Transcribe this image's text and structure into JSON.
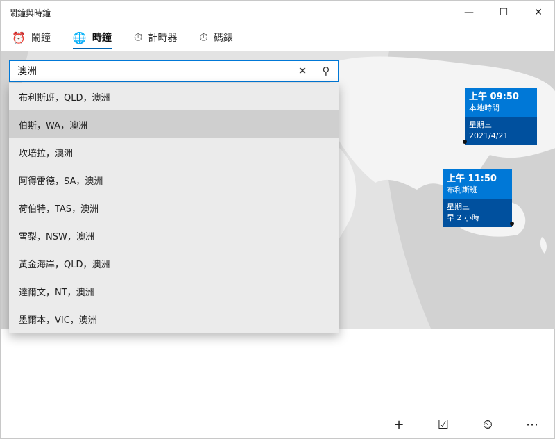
{
  "window": {
    "title": "鬧鐘與時鐘",
    "minimize_glyph": "—",
    "maximize_glyph": "☐",
    "close_glyph": "✕"
  },
  "tabs": [
    {
      "label": "鬧鐘",
      "icon": "alarm-icon",
      "glyph": "⏰",
      "active": false
    },
    {
      "label": "時鐘",
      "icon": "world-clock-icon",
      "glyph": "🌐",
      "active": true
    },
    {
      "label": "計時器",
      "icon": "timer-icon",
      "glyph": "⏱",
      "active": false
    },
    {
      "label": "碼錶",
      "icon": "stopwatch-icon",
      "glyph": "⏱",
      "active": false
    }
  ],
  "search": {
    "value": "澳洲",
    "clear_glyph": "✕",
    "search_glyph": "⚲"
  },
  "suggestions": [
    "布利斯班，QLD，澳洲",
    "伯斯，WA，澳洲",
    "坎培拉，澳洲",
    "阿得雷德，SA，澳洲",
    "荷伯特，TAS，澳洲",
    "雪梨，NSW，澳洲",
    "黃金海岸，QLD，澳洲",
    "達爾文，NT，澳洲",
    "墨爾本，VIC，澳洲"
  ],
  "cards": {
    "local": {
      "time": "上午 09:50",
      "label": "本地時間",
      "day": "星期三",
      "date": "2021/4/21"
    },
    "brisbane": {
      "time": "上午 11:50",
      "label": "布利斯班",
      "day": "星期三",
      "offset": "早 2 小時"
    }
  },
  "bottombar": {
    "add_glyph": "+",
    "select_glyph": "☑",
    "compare_glyph": "⏲",
    "more_glyph": "⋯"
  },
  "colors": {
    "accent": "#0078d7",
    "card_dark": "#00509e",
    "map_bg": "#e3e3e3"
  }
}
